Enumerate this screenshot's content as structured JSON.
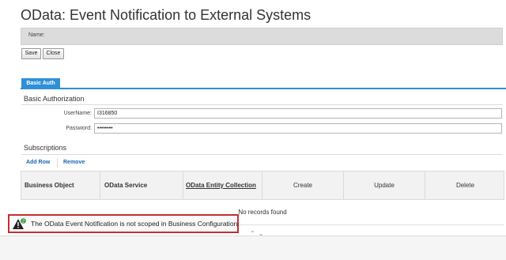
{
  "page": {
    "title": "OData: Event Notification to External Systems"
  },
  "header": {
    "name_label": "Name:"
  },
  "toolbar": {
    "save_label": "Save",
    "close_label": "Close"
  },
  "tabs": [
    {
      "label": "Basic Auth",
      "active": true
    }
  ],
  "basic_auth": {
    "section_title": "Basic Authorization",
    "username_label": "UserName:",
    "username_value": "I316850",
    "password_label": "Password:",
    "password_value": "••••••••"
  },
  "subscriptions": {
    "section_title": "Subscriptions",
    "add_row_label": "Add Row",
    "remove_label": "Remove",
    "columns": [
      "Business Object",
      "OData Service",
      "OData Entity Collection",
      "Create",
      "Update",
      "Delete"
    ],
    "empty_text": "No records found"
  },
  "message": {
    "text": "The OData Event Notification is not scoped in Business Configuration.",
    "badge_count": "2",
    "icon": "warning-icon"
  },
  "colors": {
    "accent": "#2f8fd8",
    "link": "#1a66b3",
    "error_border": "#c22f2f"
  }
}
